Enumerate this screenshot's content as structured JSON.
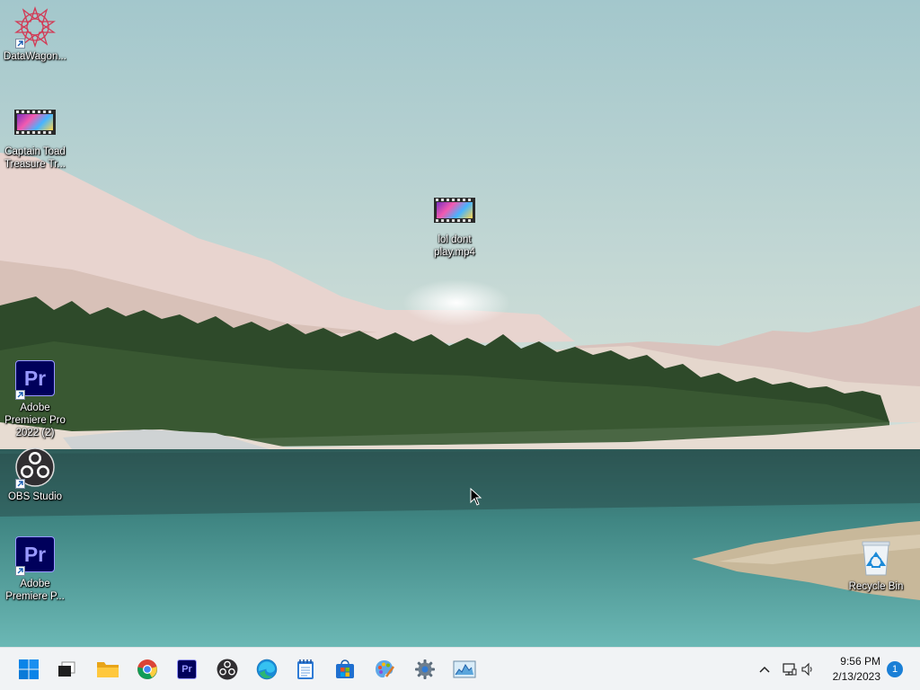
{
  "desktop": {
    "icons": [
      {
        "label": "DataWagon...",
        "icon": "datawagon-star-icon",
        "shortcut": true
      },
      {
        "label": "Captain Toad Treasure Tr...",
        "icon": "video-file-icon",
        "shortcut": false
      },
      {
        "label": "lol dont play.mp4",
        "icon": "video-file-icon",
        "shortcut": false
      },
      {
        "label": "Adobe Premiere Pro 2022 (2)",
        "icon": "premiere-pro-icon",
        "shortcut": true
      },
      {
        "label": "OBS Studio",
        "icon": "obs-icon",
        "shortcut": true
      },
      {
        "label": "Adobe Premiere P...",
        "icon": "premiere-pro-icon",
        "shortcut": true
      },
      {
        "label": "Recycle Bin",
        "icon": "recycle-bin-icon",
        "shortcut": false
      }
    ],
    "premiere_glyph": "Pr"
  },
  "taskbar": {
    "apps": [
      {
        "name": "Start",
        "icon": "windows-start-icon"
      },
      {
        "name": "Task View",
        "icon": "task-view-icon"
      },
      {
        "name": "File Explorer",
        "icon": "folder-icon"
      },
      {
        "name": "Google Chrome",
        "icon": "chrome-icon"
      },
      {
        "name": "Adobe Premiere Pro",
        "icon": "premiere-pro-icon"
      },
      {
        "name": "OBS Studio",
        "icon": "obs-icon"
      },
      {
        "name": "Microsoft Edge",
        "icon": "edge-icon"
      },
      {
        "name": "Notepad",
        "icon": "notepad-icon"
      },
      {
        "name": "Microsoft Store",
        "icon": "store-icon"
      },
      {
        "name": "Paint",
        "icon": "paint-icon"
      },
      {
        "name": "Settings",
        "icon": "gear-icon"
      },
      {
        "name": "Resource Monitor",
        "icon": "monitor-icon"
      }
    ],
    "tray": {
      "time": "9:56 PM",
      "date": "2/13/2023",
      "notifications": "1"
    }
  },
  "colors": {
    "premiere_bg": "#00005b",
    "premiere_fg": "#9999ff",
    "accent": "#1a7fd6"
  }
}
